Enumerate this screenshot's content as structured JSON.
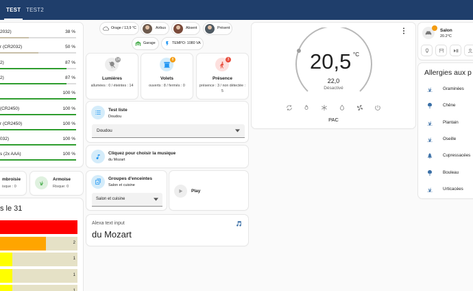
{
  "tabs": [
    {
      "label": "TEST"
    },
    {
      "label": "TEST2"
    }
  ],
  "batteries": [
    {
      "name": "2032)",
      "value": "38 %",
      "level": 38,
      "color": "#c8bfa8"
    },
    {
      "name": "r (CR2032)",
      "value": "50 %",
      "level": 50,
      "color": "#c8bfa8"
    },
    {
      "name": "2)",
      "value": "87 %",
      "level": 87,
      "color": "#2e9d2e"
    },
    {
      "name": "2)",
      "value": "87 %",
      "level": 87,
      "color": "#2e9d2e"
    },
    {
      "name": "",
      "value": "100 %",
      "level": 100,
      "color": "#2e9d2e"
    },
    {
      "name": "(CR2450)",
      "value": "100 %",
      "level": 100,
      "color": "#2e9d2e"
    },
    {
      "name": "r (CR2450)",
      "value": "100 %",
      "level": 100,
      "color": "#2e9d2e"
    },
    {
      "name": "032)",
      "value": "100 %",
      "level": 100,
      "color": "#2e9d2e"
    },
    {
      "name": "s (2x AAA)",
      "value": "100 %",
      "level": 100,
      "color": "#2e9d2e"
    }
  ],
  "pollen_small": [
    {
      "name": "mbroisie",
      "sub": "isque : 0"
    },
    {
      "name": "Armoise",
      "sub": "Risque: 0"
    }
  ],
  "forecast": {
    "title": "s le 31",
    "rows": [
      {
        "value": "",
        "level": 1.0,
        "color": "#ff0000"
      },
      {
        "value": "2",
        "level": 0.59,
        "color": "#ffa500"
      },
      {
        "value": "1",
        "level": 0.16,
        "color": "#ffff00"
      },
      {
        "value": "1",
        "level": 0.16,
        "color": "#ffff00"
      },
      {
        "value": "1",
        "level": 0.16,
        "color": "#ffff00"
      }
    ]
  },
  "chips": {
    "weather": "Orage / 13,9 °C",
    "person1": "Airbus",
    "person2": "Absent",
    "person3": "Présent",
    "garage": "Garage",
    "tempo": "TEMPO: 1080 VA"
  },
  "tiles": [
    {
      "title": "Lumières",
      "sub": "allumées : 0 / éteintes : 14",
      "badge": "14",
      "badge_color": "#9e9e9e",
      "icon_bg": "#eeeeee",
      "icon_color": "#888888"
    },
    {
      "title": "Volets",
      "sub": "ouverts : 8 / fermés : 0",
      "badge": "8",
      "badge_color": "#f39c12",
      "icon_bg": "#d4ecfa",
      "icon_color": "#2196f3"
    },
    {
      "title": "Présence",
      "sub": "présence : 3 / non détectée : 5",
      "badge": "3",
      "badge_color": "#e74c3c",
      "icon_bg": "#fde0de",
      "icon_color": "#e74c3c"
    }
  ],
  "test_liste": {
    "title": "Test liste",
    "sub": "Doudou",
    "selected": "Doudou"
  },
  "music": {
    "title": "Cliquez pour choisir la musique",
    "sub": "du Mozart"
  },
  "speakers": {
    "title": "Groupes d'enceintes",
    "sub": "Salon et cuisine",
    "selected": "Salon et cuisine"
  },
  "play": {
    "label": "Play"
  },
  "alexa": {
    "label": "Alexa text input",
    "value": "du Mozart"
  },
  "thermostat": {
    "current": "20,5",
    "unit": "°C",
    "target": "22,0",
    "mode": "Désactivé",
    "name": "PAC"
  },
  "salon": {
    "name": "Salon",
    "temp": "20.2°C"
  },
  "allergies": {
    "title": "Allergies aux p",
    "items": [
      {
        "name": "Graminées",
        "icon": "grass-icon"
      },
      {
        "name": "Chêne",
        "icon": "tree-icon"
      },
      {
        "name": "Plantain",
        "icon": "grass-icon"
      },
      {
        "name": "Oseille",
        "icon": "grass-icon"
      },
      {
        "name": "Cupressacées",
        "icon": "conifer-icon"
      },
      {
        "name": "Bouleau",
        "icon": "tree-icon"
      },
      {
        "name": "Urticacées",
        "icon": "grass-icon"
      }
    ]
  },
  "colors": {
    "header": "#1f3e6b",
    "accent": "#2196f3",
    "icon_blue": "#3a6fa6"
  }
}
